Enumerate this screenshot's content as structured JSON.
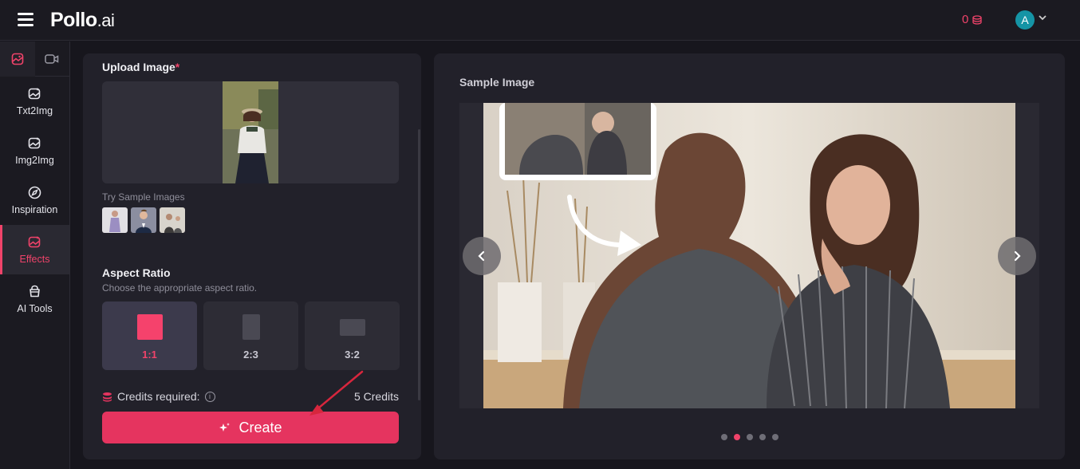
{
  "header": {
    "logo_text": "Pollo",
    "logo_suffix": ".ai",
    "credits_value": "0",
    "avatar_initial": "A"
  },
  "sidebar": {
    "tabs": [
      {
        "icon": "image-icon",
        "active": true
      },
      {
        "icon": "video-icon",
        "active": false
      }
    ],
    "items": [
      {
        "label": "Txt2Img",
        "icon": "image-sparkle-icon"
      },
      {
        "label": "Img2Img",
        "icon": "image-sparkle-icon"
      },
      {
        "label": "Inspiration",
        "icon": "compass-icon"
      },
      {
        "label": "Effects",
        "icon": "image-sparkle-icon",
        "active": true
      },
      {
        "label": "AI Tools",
        "icon": "toolbox-icon"
      }
    ]
  },
  "upload": {
    "title": "Upload Image",
    "required_mark": "*",
    "sample_label": "Try Sample Images"
  },
  "aspect": {
    "title": "Aspect Ratio",
    "subtitle": "Choose the appropriate aspect ratio.",
    "options": [
      {
        "label": "1:1",
        "selected": true
      },
      {
        "label": "2:3",
        "selected": false
      },
      {
        "label": "3:2",
        "selected": false
      }
    ]
  },
  "credits": {
    "label": "Credits required:",
    "value": "5 Credits"
  },
  "create_button": {
    "label": "Create"
  },
  "sample": {
    "title": "Sample Image",
    "slide_count": 5,
    "active_slide": 2
  },
  "colors": {
    "accent": "#f0436a",
    "button": "#e5345f",
    "background": "#17161d",
    "panel": "#22212a"
  }
}
